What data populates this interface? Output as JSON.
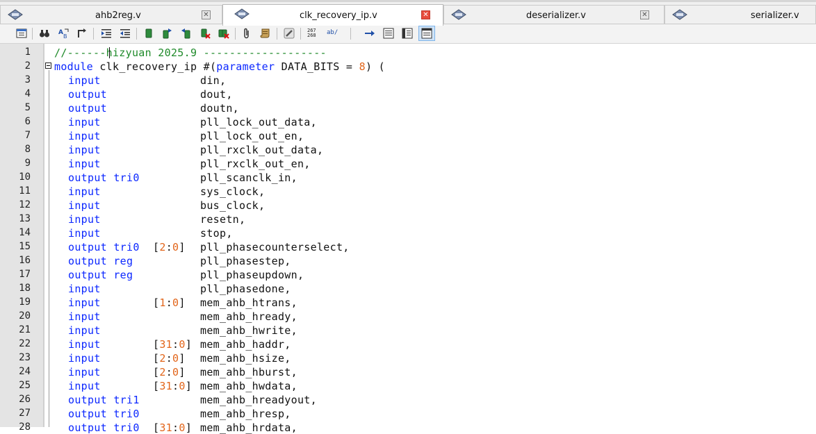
{
  "tabs": [
    {
      "label": "ahb2reg.v",
      "active": false
    },
    {
      "label": "clk_recovery_ip.v",
      "active": true
    },
    {
      "label": "deserializer.v",
      "active": false
    },
    {
      "label": "serializer.v",
      "active": false
    }
  ],
  "toolbar": {
    "counts_label": "267\n268",
    "ab_label": "ab/"
  },
  "colors": {
    "keyword": "#0b27ff",
    "number": "#e2651a",
    "comment": "#1f8a2a",
    "gutter": "#e4e4e4"
  },
  "editor": {
    "lines": [
      {
        "n": "1",
        "a": "",
        "b": "",
        "c": "",
        "cmt": "//------hizyuan 2025.9 -------------------"
      },
      {
        "n": "2",
        "a": "module",
        "b": " clk_recovery_ip #(",
        "kw2": "parameter",
        "c": " DATA_BITS = ",
        "num": "8",
        "d": ") ("
      },
      {
        "n": "3",
        "dir": "input",
        "type": "",
        "range": "",
        "name": "din,"
      },
      {
        "n": "4",
        "dir": "output",
        "type": "",
        "range": "",
        "name": "dout,"
      },
      {
        "n": "5",
        "dir": "output",
        "type": "",
        "range": "",
        "name": "doutn,"
      },
      {
        "n": "6",
        "dir": "input",
        "type": "",
        "range": "",
        "name": "pll_lock_out_data,"
      },
      {
        "n": "7",
        "dir": "input",
        "type": "",
        "range": "",
        "name": "pll_lock_out_en,"
      },
      {
        "n": "8",
        "dir": "input",
        "type": "",
        "range": "",
        "name": "pll_rxclk_out_data,"
      },
      {
        "n": "9",
        "dir": "input",
        "type": "",
        "range": "",
        "name": "pll_rxclk_out_en,"
      },
      {
        "n": "10",
        "dir": "output",
        "type": "tri0",
        "range": "",
        "name": "pll_scanclk_in,"
      },
      {
        "n": "11",
        "dir": "input",
        "type": "",
        "range": "",
        "name": "sys_clock,"
      },
      {
        "n": "12",
        "dir": "input",
        "type": "",
        "range": "",
        "name": "bus_clock,"
      },
      {
        "n": "13",
        "dir": "input",
        "type": "",
        "range": "",
        "name": "resetn,"
      },
      {
        "n": "14",
        "dir": "input",
        "type": "",
        "range": "",
        "name": "stop,"
      },
      {
        "n": "15",
        "dir": "output",
        "type": "tri0",
        "r1": "2",
        "r2": "0",
        "name": "pll_phasecounterselect,"
      },
      {
        "n": "16",
        "dir": "output",
        "type": "reg",
        "range": "",
        "name": "pll_phasestep,"
      },
      {
        "n": "17",
        "dir": "output",
        "type": "reg",
        "range": "",
        "name": "pll_phaseupdown,"
      },
      {
        "n": "18",
        "dir": "input",
        "type": "",
        "range": "",
        "name": "pll_phasedone,"
      },
      {
        "n": "19",
        "dir": "input",
        "type": "",
        "r1": "1",
        "r2": "0",
        "name": "mem_ahb_htrans,"
      },
      {
        "n": "20",
        "dir": "input",
        "type": "",
        "range": "",
        "name": "mem_ahb_hready,"
      },
      {
        "n": "21",
        "dir": "input",
        "type": "",
        "range": "",
        "name": "mem_ahb_hwrite,"
      },
      {
        "n": "22",
        "dir": "input",
        "type": "",
        "r1": "31",
        "r2": "0",
        "name": "mem_ahb_haddr,"
      },
      {
        "n": "23",
        "dir": "input",
        "type": "",
        "r1": "2",
        "r2": "0",
        "name": "mem_ahb_hsize,"
      },
      {
        "n": "24",
        "dir": "input",
        "type": "",
        "r1": "2",
        "r2": "0",
        "name": "mem_ahb_hburst,"
      },
      {
        "n": "25",
        "dir": "input",
        "type": "",
        "r1": "31",
        "r2": "0",
        "name": "mem_ahb_hwdata,"
      },
      {
        "n": "26",
        "dir": "output",
        "type": "tri1",
        "range": "",
        "name": "mem_ahb_hreadyout,"
      },
      {
        "n": "27",
        "dir": "output",
        "type": "tri0",
        "range": "",
        "name": "mem_ahb_hresp,"
      },
      {
        "n": "28",
        "dir": "output",
        "type": "tri0",
        "r1": "31",
        "r2": "0",
        "name": "mem_ahb_hrdata,"
      }
    ]
  }
}
